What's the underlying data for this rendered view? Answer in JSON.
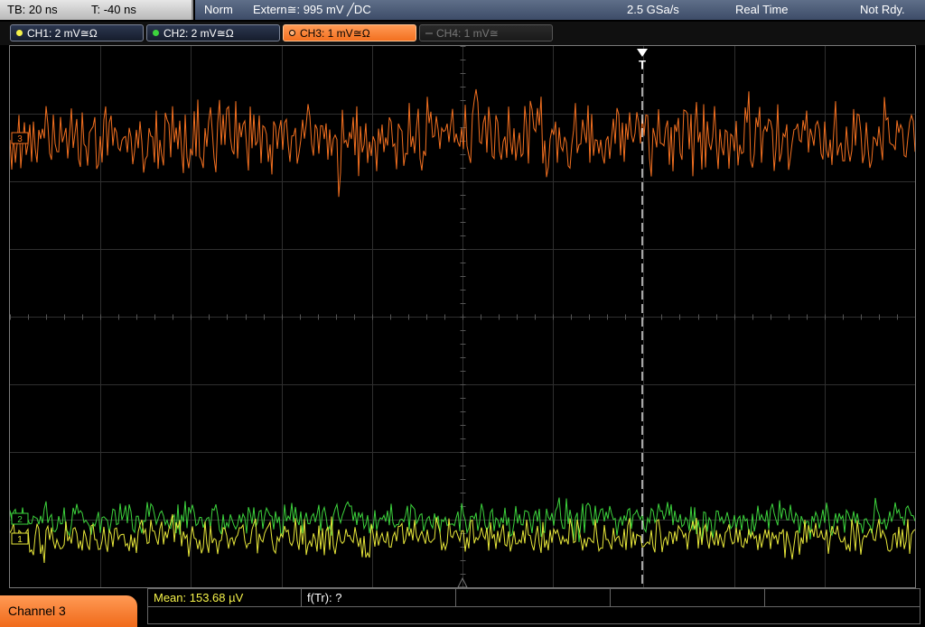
{
  "header": {
    "timebase": "TB: 20 ns",
    "trigger_time": "T: -40 ns",
    "mode": "Norm",
    "trigger": "Extern≅: 995 mV ╱DC",
    "sample_rate": "2.5 GSa/s",
    "acquisition": "Real Time",
    "status": "Not Rdy."
  },
  "channels": [
    {
      "label": "CH1: 2 mV≅Ω",
      "color": "#f5f24a",
      "state": "on"
    },
    {
      "label": "CH2: 2 mV≅Ω",
      "color": "#3dd43d",
      "state": "on"
    },
    {
      "label": "CH3: 1 mV≅Ω",
      "color": "#f37020",
      "state": "active"
    },
    {
      "label": "CH4: 1 mV≅",
      "color": "#777777",
      "state": "off"
    }
  ],
  "waveforms": {
    "ch3_marker": "3",
    "ch2_marker": "2",
    "ch1_marker": "1",
    "trigger_marker": "T"
  },
  "bottom": {
    "channel_label": "Channel 3",
    "mean": "Mean: 153.68 µV",
    "ftr": "f(Tr): ?"
  }
}
